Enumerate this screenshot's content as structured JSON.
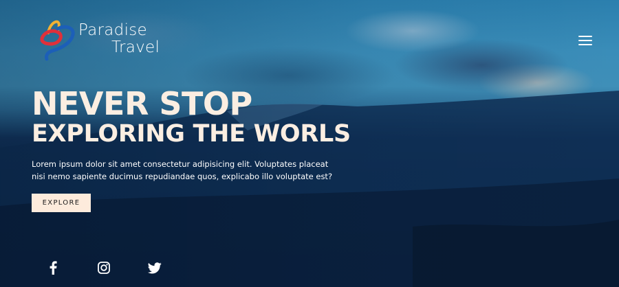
{
  "brand": {
    "line1": "Paradise",
    "line2": "Travel"
  },
  "nav": {
    "menu_icon": "hamburger-menu-icon"
  },
  "hero": {
    "headline_line1": "NEVER STOP",
    "headline_line2": "EXPLORING THE WORLS",
    "description": "Lorem ipsum dolor sit amet consectetur adipisicing elit. Voluptates placeat nisi nemo sapiente ducimus repudiandae quos, explicabo illo voluptate est?",
    "cta_label": "EXPLORE"
  },
  "social": [
    {
      "icon": "facebook-icon"
    },
    {
      "icon": "instagram-icon"
    },
    {
      "icon": "twitter-icon"
    }
  ],
  "colors": {
    "headline": "#fbeee2",
    "cta_background": "#fdebdc",
    "logo_red": "#e0303a",
    "logo_blue": "#1c5fb8",
    "logo_yellow": "#f2b132"
  }
}
